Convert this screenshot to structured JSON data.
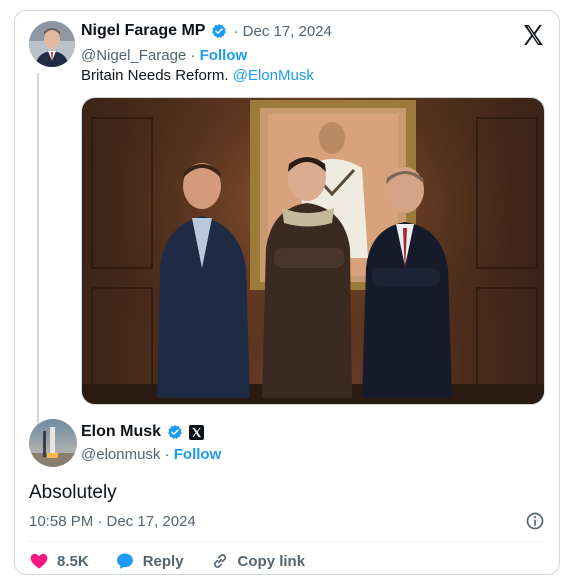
{
  "parent_tweet": {
    "display_name": "Nigel Farage MP",
    "date": "· Dec 17, 2024",
    "handle": "@Nigel_Farage ·",
    "follow": "Follow",
    "text_prefix": "Britain Needs Reform.",
    "mention": "@ElonMusk"
  },
  "reply_tweet": {
    "display_name": "Elon Musk",
    "handle": "@elonmusk ·",
    "follow": "Follow",
    "text": "Absolutely",
    "timestamp": "10:58 PM · Dec 17, 2024"
  },
  "actions": {
    "like_count": "8.5K",
    "reply_label": "Reply",
    "copy_label": "Copy link"
  },
  "colors": {
    "accent": "#1d9bf0",
    "like": "#f91880",
    "text": "#0f1419",
    "muted": "#536471"
  }
}
